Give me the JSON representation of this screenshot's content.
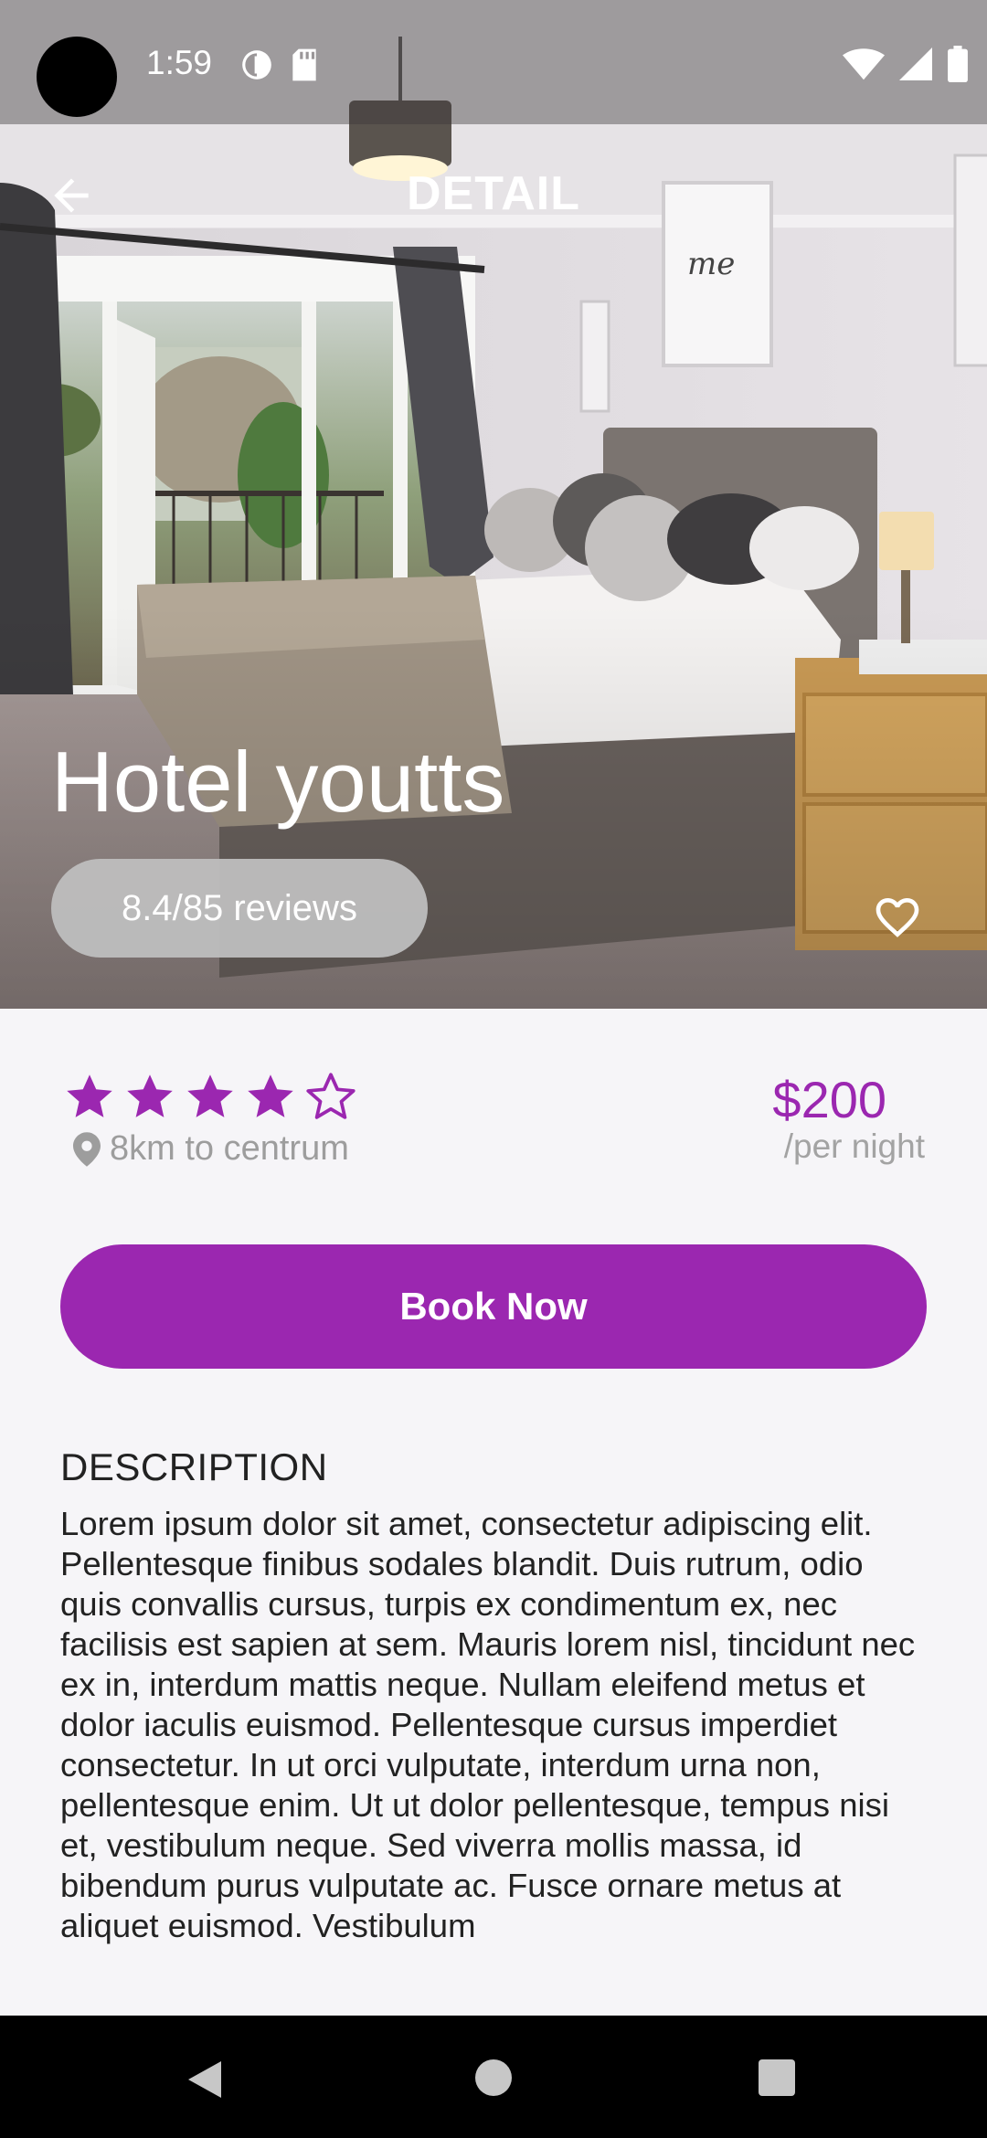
{
  "status_bar": {
    "time": "1:59",
    "icons_left": [
      "data-saver-icon",
      "sd-card-icon"
    ],
    "icons_right": [
      "wifi-icon",
      "cell-signal-icon",
      "battery-icon"
    ]
  },
  "header": {
    "title": "DETAIL",
    "back_icon": "arrow-back-icon"
  },
  "hotel": {
    "name": "Hotel youtts",
    "reviews": "8.4/85 reviews",
    "favorite_icon": "heart-outline-icon",
    "rating": 4,
    "rating_max": 5,
    "distance": "8km to centrum",
    "distance_icon": "location-pin-icon",
    "price": "$200",
    "price_unit": "/per night"
  },
  "actions": {
    "book_label": "Book Now"
  },
  "description": {
    "heading": "DESCRIPTION",
    "body": "Lorem ipsum dolor sit amet, consectetur adipiscing elit. Pellentesque finibus sodales blandit. Duis rutrum, odio quis convallis cursus, turpis ex condimentum ex, nec facilisis est sapien at sem. Mauris lorem nisl, tincidunt nec ex in, interdum mattis neque. Nullam eleifend metus et dolor iaculis euismod. Pellentesque cursus imperdiet consectetur. In ut orci vulputate, interdum urna non, pellentesque enim. Ut ut dolor pellentesque, tempus nisi et, vestibulum neque. Sed viverra mollis massa, id bibendum purus vulputate ac. Fusce ornare metus at aliquet euismod. Vestibulum"
  },
  "nav_bar": {
    "icons": [
      "nav-back-icon",
      "nav-home-icon",
      "nav-recents-icon"
    ]
  },
  "colors": {
    "accent": "#9b27b0",
    "muted_text": "#9d9d9d",
    "background": "#f6f5f8"
  }
}
